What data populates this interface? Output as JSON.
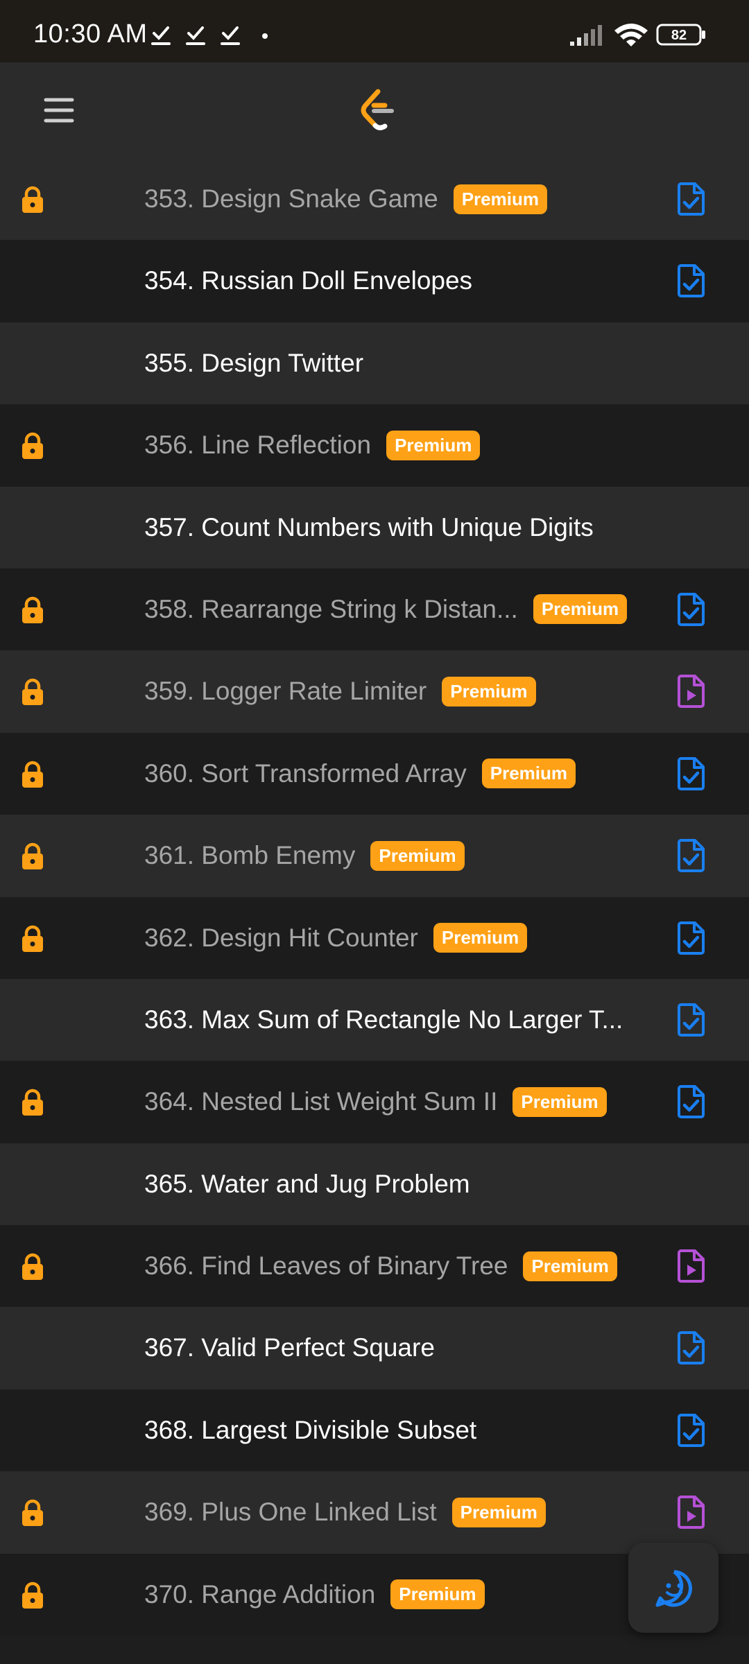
{
  "status_bar": {
    "time": "10:30 AM",
    "battery": "82"
  },
  "app_bar": {
    "menu_icon": "hamburger-menu-icon",
    "logo_icon": "leetcode-logo-icon"
  },
  "colors": {
    "premium_badge": "#ffa116",
    "lock": "#ffa116",
    "solution_article": "#1a7ff0",
    "solution_video": "#b551d6"
  },
  "problems": [
    {
      "title": "353. Design Snake Game",
      "locked": true,
      "premium_label": "Premium",
      "solution": "article"
    },
    {
      "title": "354. Russian Doll Envelopes",
      "locked": false,
      "premium_label": "",
      "solution": "article"
    },
    {
      "title": "355. Design Twitter",
      "locked": false,
      "premium_label": "",
      "solution": "none"
    },
    {
      "title": "356. Line Reflection",
      "locked": true,
      "premium_label": "Premium",
      "solution": "none"
    },
    {
      "title": "357. Count Numbers with Unique Digits",
      "locked": false,
      "premium_label": "",
      "solution": "none"
    },
    {
      "title": "358. Rearrange String k Distan...",
      "locked": true,
      "premium_label": "Premium",
      "solution": "article"
    },
    {
      "title": "359. Logger Rate Limiter",
      "locked": true,
      "premium_label": "Premium",
      "solution": "video"
    },
    {
      "title": "360. Sort Transformed Array",
      "locked": true,
      "premium_label": "Premium",
      "solution": "article"
    },
    {
      "title": "361. Bomb Enemy",
      "locked": true,
      "premium_label": "Premium",
      "solution": "article"
    },
    {
      "title": "362. Design Hit Counter",
      "locked": true,
      "premium_label": "Premium",
      "solution": "article"
    },
    {
      "title": "363. Max Sum of Rectangle No Larger T...",
      "locked": false,
      "premium_label": "",
      "solution": "article"
    },
    {
      "title": "364. Nested List Weight Sum II",
      "locked": true,
      "premium_label": "Premium",
      "solution": "article"
    },
    {
      "title": "365. Water and Jug Problem",
      "locked": false,
      "premium_label": "",
      "solution": "none"
    },
    {
      "title": "366. Find Leaves of Binary Tree",
      "locked": true,
      "premium_label": "Premium",
      "solution": "video"
    },
    {
      "title": "367. Valid Perfect Square",
      "locked": false,
      "premium_label": "",
      "solution": "article"
    },
    {
      "title": "368. Largest Divisible Subset",
      "locked": false,
      "premium_label": "",
      "solution": "article"
    },
    {
      "title": "369. Plus One Linked List",
      "locked": true,
      "premium_label": "Premium",
      "solution": "video"
    },
    {
      "title": "370. Range Addition",
      "locked": true,
      "premium_label": "Premium",
      "solution": "none"
    }
  ],
  "fab_icon": "feedback-chat-icon"
}
